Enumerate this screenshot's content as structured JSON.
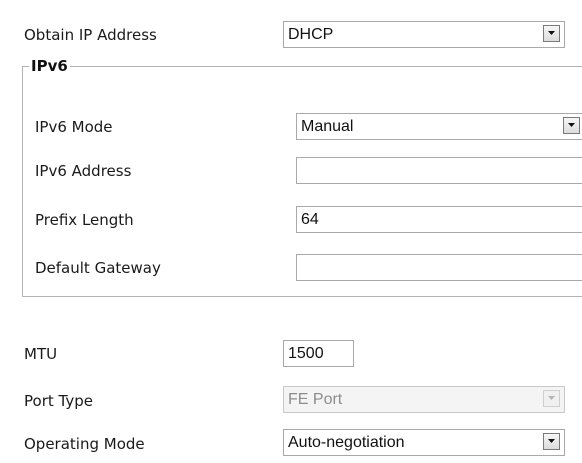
{
  "obtain_ip": {
    "label": "Obtain IP Address",
    "value": "DHCP"
  },
  "ipv6_group": {
    "legend": "IPv6",
    "mode": {
      "label": "IPv6 Mode",
      "value": "Manual"
    },
    "address": {
      "label": "IPv6 Address",
      "value": ""
    },
    "prefix_length": {
      "label": "Prefix Length",
      "value": "64"
    },
    "gateway": {
      "label": "Default Gateway",
      "value": ""
    }
  },
  "mtu": {
    "label": "MTU",
    "value": "1500"
  },
  "port_type": {
    "label": "Port Type",
    "value": "FE Port",
    "disabled": true
  },
  "operating_mode": {
    "label": "Operating Mode",
    "value": "Auto-negotiation"
  }
}
